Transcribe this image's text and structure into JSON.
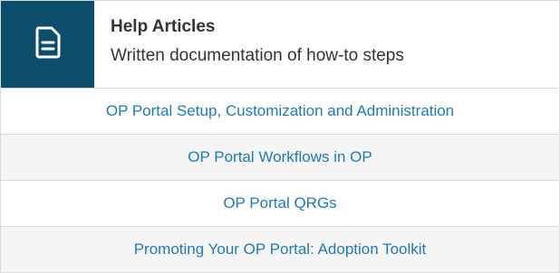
{
  "card": {
    "icon": "document-icon",
    "title": "Help Articles",
    "subtitle": "Written documentation of how-to steps"
  },
  "links": [
    "OP Portal Setup, Customization and Administration",
    "OP Portal Workflows in OP",
    "OP Portal QRGs",
    "Promoting Your OP Portal: Adoption Toolkit"
  ],
  "colors": {
    "tile": "#0b4d6a",
    "link": "#1e7bb8",
    "alt_row": "#f5f5f5",
    "border": "#d9d9d9"
  }
}
